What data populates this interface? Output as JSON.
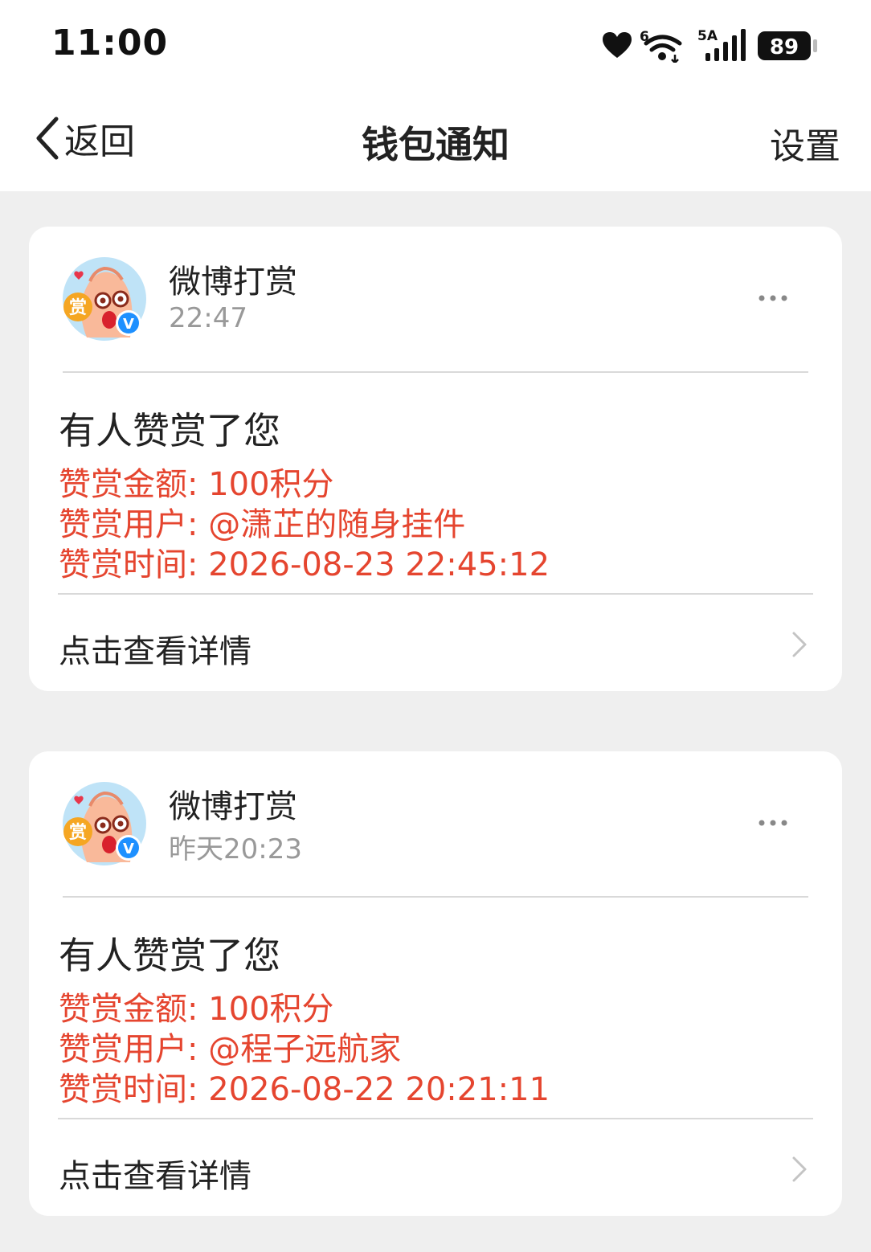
{
  "status_bar": {
    "time": "11:00",
    "wifi_badge": "6",
    "network_label": "5A",
    "battery": "89"
  },
  "nav": {
    "back_label": "返回",
    "title": "钱包通知",
    "settings_label": "设置"
  },
  "notifications": [
    {
      "sender": "微博打赏",
      "time": "22:47",
      "title": "有人赞赏了您",
      "amount": "赞赏金额: 100积分",
      "user": "赞赏用户: @潇芷的随身挂件",
      "reward_time": "赞赏时间: 2026-08-23 22:45:12",
      "link_label": "点击查看详情"
    },
    {
      "sender": "微博打赏",
      "time": "昨天20:23",
      "title": "有人赞赏了您",
      "amount": "赞赏金额: 100积分",
      "user": "赞赏用户: @程子远航家",
      "reward_time": "赞赏时间: 2026-08-22 20:21:11",
      "link_label": "点击查看详情"
    }
  ],
  "icons": {
    "avatar_badge_text": "赏",
    "verified_badge_text": "V"
  },
  "colors": {
    "accent_red": "#e5452f",
    "background": "#efefef",
    "card": "#ffffff",
    "muted_text": "#999999",
    "verified_blue": "#1e90ff",
    "badge_orange": "#f5a623"
  }
}
